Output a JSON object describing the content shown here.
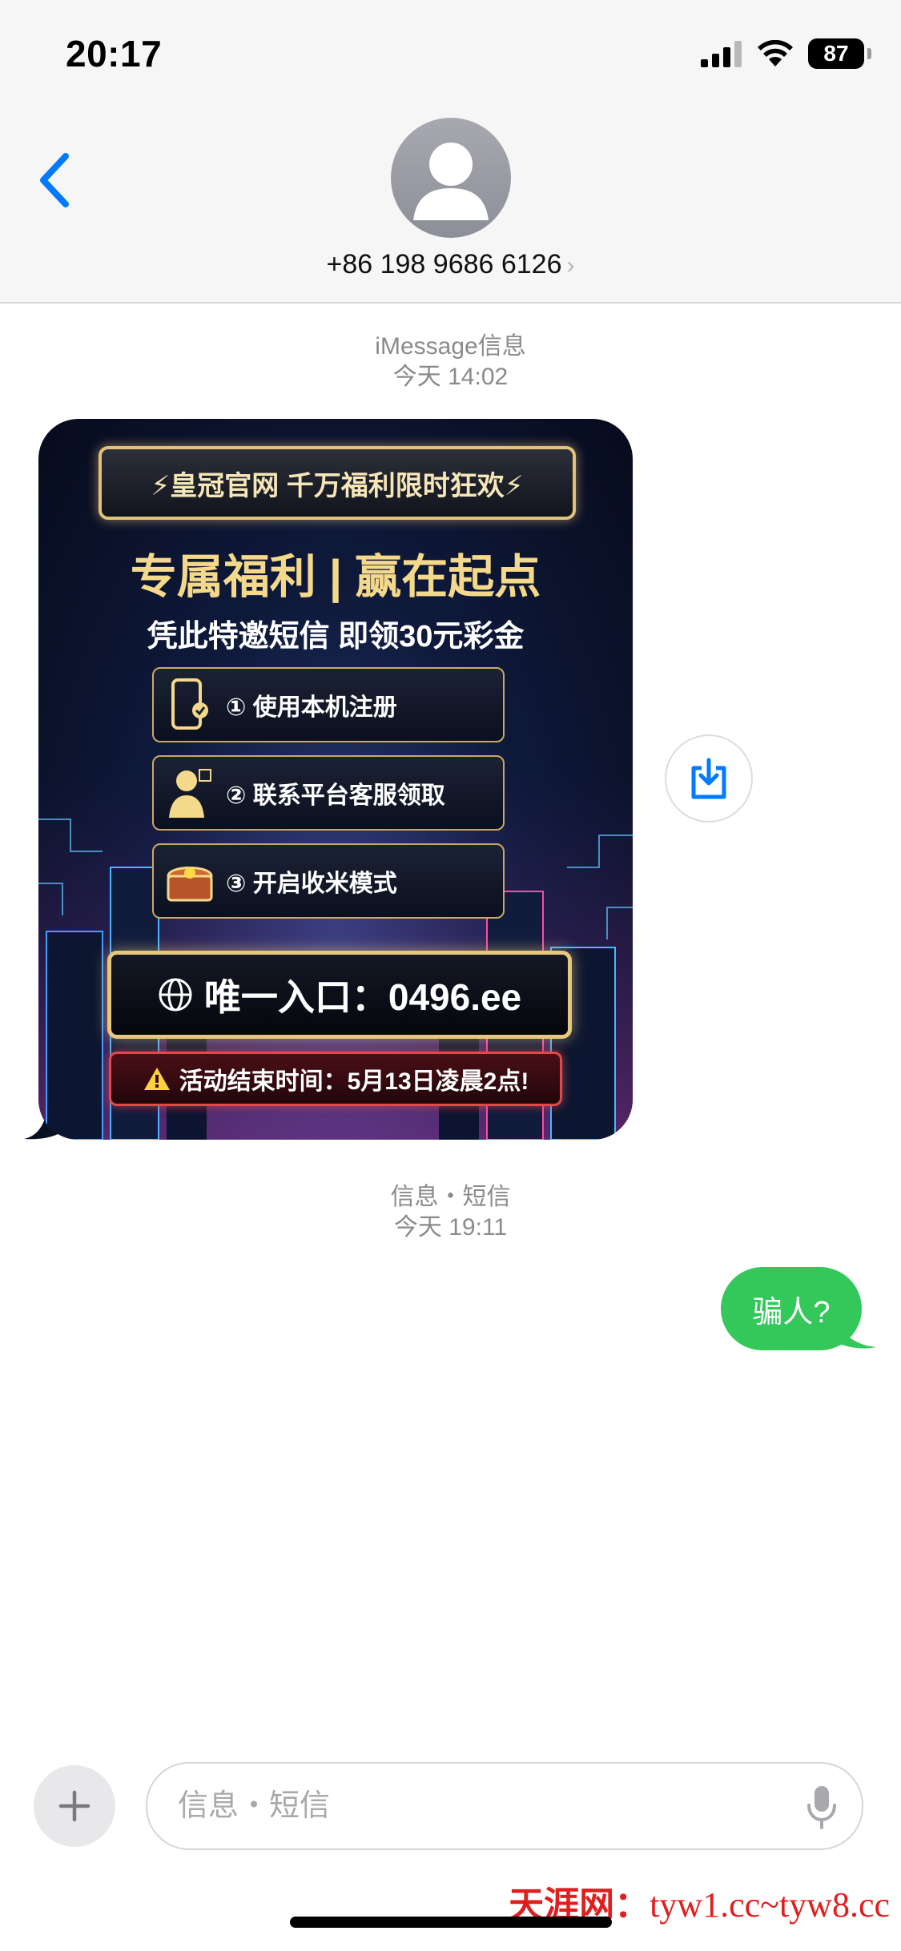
{
  "status_bar": {
    "time": "20:17",
    "battery": "87"
  },
  "header": {
    "contact": "+86 198 9686 6126",
    "chevron": "›"
  },
  "thread": {
    "ts1": {
      "service": "iMessage",
      "label": "信息",
      "date": "今天 14:02"
    },
    "image_message": {
      "banner": "⚡皇冠官网 千万福利限时狂欢⚡",
      "headline": "专属福利 | 赢在起点",
      "subline": "凭此特邀短信 即领30元彩金",
      "steps": [
        "① 使用本机注册",
        "② 联系平台客服领取",
        "③ 开启收米模式"
      ],
      "entry": "唯一入口：0496.ee",
      "end_time": "活动结束时间：5月13日凌晨2点!"
    },
    "ts2": {
      "label": "信息・短信",
      "date": "今天 19:11"
    },
    "sent_message": "骗人?"
  },
  "composer": {
    "placeholder": "信息・短信"
  },
  "watermark": {
    "site": "天涯网：",
    "url": "tyw1.cc~tyw8.cc"
  },
  "colors": {
    "accent_blue": "#007aff",
    "sent_green": "#34c759",
    "watermark_red": "#e01e1e"
  }
}
